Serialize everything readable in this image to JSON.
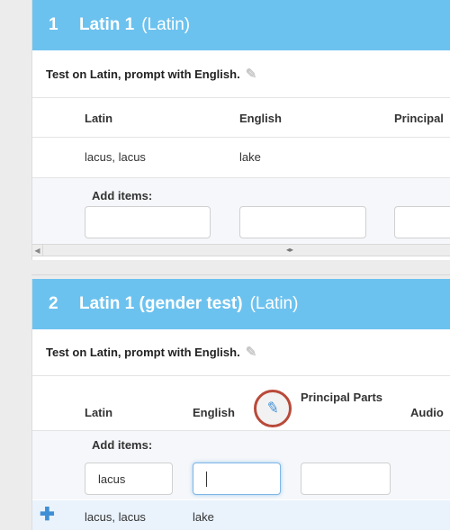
{
  "list1": {
    "number": "1",
    "title": "Latin 1",
    "language": "(Latin)",
    "description": "Test on Latin, prompt with English.",
    "columns": [
      "Latin",
      "English",
      "Principal"
    ],
    "rows": [
      {
        "latin": "lacus, lacus",
        "english": "lake"
      }
    ],
    "add_items_label": "Add items:",
    "inputs": [
      {
        "value": ""
      },
      {
        "value": ""
      },
      {
        "value": ""
      }
    ]
  },
  "list2": {
    "number": "2",
    "title": "Latin 1 (gender test)",
    "language": "(Latin)",
    "description": "Test on Latin, prompt with English.",
    "columns": [
      "Latin",
      "English",
      "Principal Parts",
      "Audio"
    ],
    "add_items_label": "Add items:",
    "inputs": [
      {
        "value": "lacus"
      },
      {
        "value": ""
      },
      {
        "value": ""
      }
    ],
    "rows": [
      {
        "latin": "lacus, lacus",
        "english": "lake"
      }
    ]
  },
  "icons": {
    "edit": "pencil-icon",
    "add": "plus-icon",
    "scroll_left": "arrow-left-icon",
    "scroll_grip": "grip-icon"
  },
  "colors": {
    "header_bg": "#6cc2ef",
    "accent": "#3f8fd6",
    "highlight_ring": "#b94a3a"
  }
}
